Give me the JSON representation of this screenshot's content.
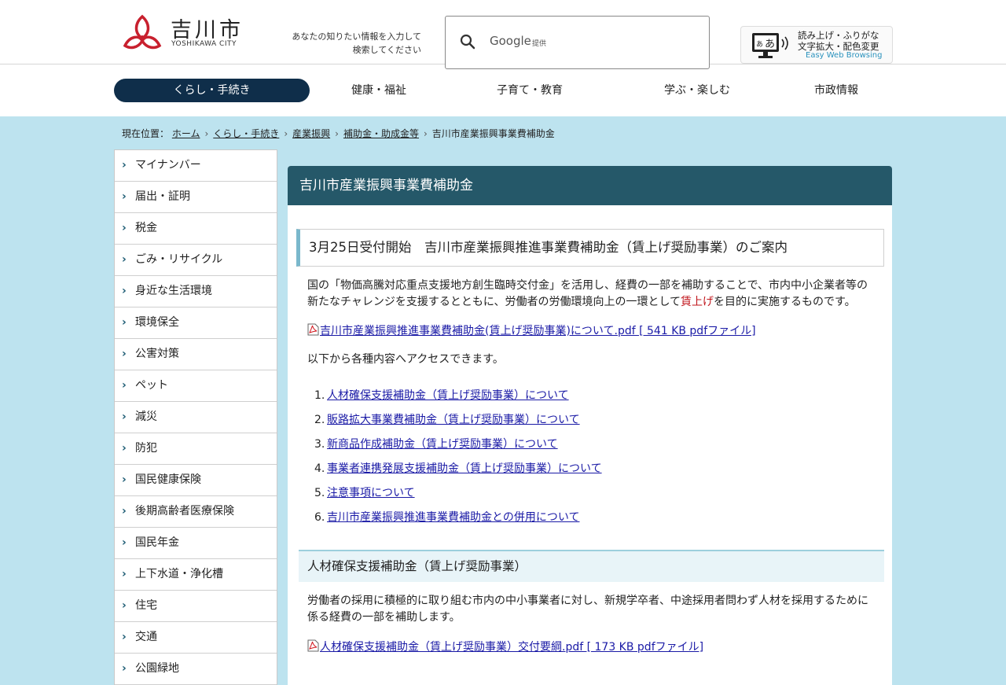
{
  "header": {
    "city_name": "吉川市",
    "city_name_en": "YOSHIKAWA CITY",
    "search_help_line1": "あなたの知りたい情報を入力して",
    "search_help_line2": "検索してください",
    "search_provider": "Google",
    "search_provider_suffix": "提供",
    "web_browsing_line1": "読み上げ・ふりがな",
    "web_browsing_line2": "文字拡大・配色変更",
    "web_browsing_line3": "Easy Web Browsing"
  },
  "global_nav": [
    {
      "label": "くらし・手続き",
      "active": true
    },
    {
      "label": "健康・福祉",
      "active": false
    },
    {
      "label": "子育て・教育",
      "active": false
    },
    {
      "label": "学ぶ・楽しむ",
      "active": false
    },
    {
      "label": "市政情報",
      "active": false
    }
  ],
  "breadcrumb": {
    "prefix": "現在位置：",
    "links": [
      "ホーム",
      "くらし・手続き",
      "産業振興",
      "補助金・助成金等"
    ],
    "separator": "›",
    "current": "吉川市産業振興事業費補助金"
  },
  "sidebar": {
    "chevron": "›",
    "items": [
      "マイナンバー",
      "届出・証明",
      "税金",
      "ごみ・リサイクル",
      "身近な生活環境",
      "環境保全",
      "公害対策",
      "ペット",
      "減災",
      "防犯",
      "国民健康保険",
      "後期高齢者医療保険",
      "国民年金",
      "上下水道・浄化槽",
      "住宅",
      "交通",
      "公園緑地"
    ]
  },
  "main": {
    "page_title": "吉川市産業振興事業費補助金",
    "section_heading": "3月25日受付開始　吉川市産業振興推進事業費補助金（賃上げ奨励事業）のご案内",
    "intro_part1": "国の「物価高騰対応重点支援地方創生臨時交付金」を活用し、経費の一部を補助することで、市内中小企業者等の新たなチャレンジを支援するとともに、労働者の労働環境向上の一環として",
    "intro_highlight": "賃上げ",
    "intro_part2": "を目的に実施するものです。",
    "pdf_link_1": "吉川市産業振興推進事業費補助金(賃上げ奨励事業)について.pdf [ 541 KB pdfファイル]",
    "access_text": "以下から各種内容へアクセスできます。",
    "list": [
      {
        "num": "1.",
        "label": "人材確保支援補助金（賃上げ奨励事業）について"
      },
      {
        "num": "2.",
        "label": "販路拡大事業費補助金（賃上げ奨励事業）について"
      },
      {
        "num": "3.",
        "label": "新商品作成補助金（賃上げ奨励事業）について"
      },
      {
        "num": "4.",
        "label": "事業者連携発展支援補助金（賃上げ奨励事業）について"
      },
      {
        "num": "5.",
        "label": "注意事項について"
      },
      {
        "num": "6.",
        "label": "吉川市産業振興推進事業費補助金との併用について"
      }
    ],
    "subheading": "人材確保支援補助金（賃上げ奨励事業）",
    "sub_text": "労働者の採用に積極的に取り組む市内の中小事業者に対し、新規学卒者、中途採用者問わず人材を採用するために係る経費の一部を補助します。",
    "pdf_link_2": "人材確保支援補助金（賃上げ奨励事業）交付要綱.pdf [ 173 KB pdfファイル]"
  },
  "colors": {
    "page_bg": "#bde3ef",
    "nav_active": "#0f2e4a",
    "title_bar": "#255869",
    "link": "#1a1aa6",
    "highlight": "#c0151b",
    "logo_red": "#c8202e"
  }
}
